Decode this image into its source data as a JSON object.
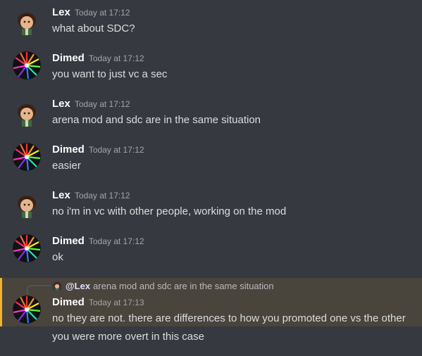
{
  "messages": [
    {
      "author": "Lex",
      "time": "Today at 17:12",
      "text": "what about SDC?",
      "avatar": "lex-avatar"
    },
    {
      "author": "Dimed",
      "time": "Today at 17:12",
      "text": "you want to just vc a sec",
      "avatar": "dimed-avatar"
    },
    {
      "author": "Lex",
      "time": "Today at 17:12",
      "text": "arena mod and sdc are in the same situation",
      "avatar": "lex-avatar"
    },
    {
      "author": "Dimed",
      "time": "Today at 17:12",
      "text": "easier",
      "avatar": "dimed-avatar"
    },
    {
      "author": "Lex",
      "time": "Today at 17:12",
      "text": "no i'm in vc with other people, working on the mod",
      "avatar": "lex-avatar"
    },
    {
      "author": "Dimed",
      "time": "Today at 17:12",
      "text": "ok",
      "avatar": "dimed-avatar"
    }
  ],
  "reply_message": {
    "reply_to": {
      "mention": "@Lex",
      "text": "arena mod and sdc are in the same situation"
    },
    "author": "Dimed",
    "time": "Today at 17:13",
    "text": "no they are not. there are differences to how you promoted one vs the other",
    "highlight_color": "#f0b232"
  },
  "followup": {
    "text": "you were more overt in this case"
  }
}
